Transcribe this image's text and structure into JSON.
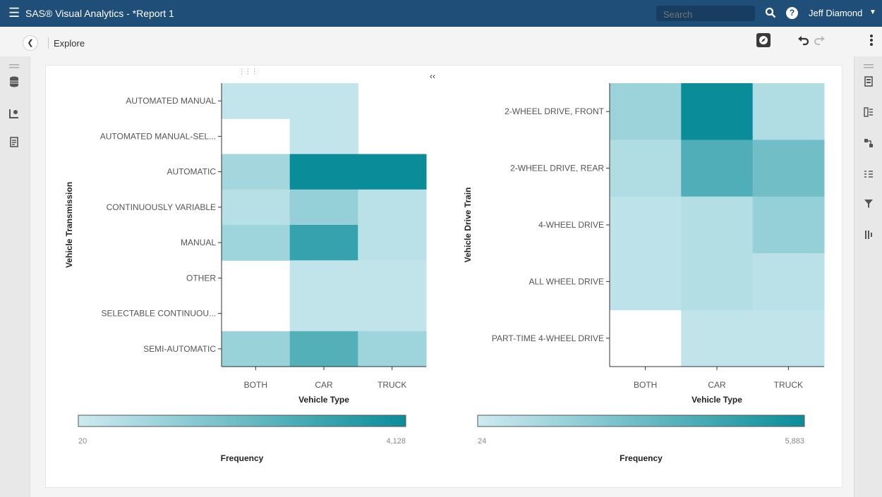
{
  "topbar": {
    "app_title": "SAS® Visual Analytics - *Report 1",
    "search_placeholder": "Search",
    "user_name": "Jeff Diamond"
  },
  "subbar": {
    "breadcrumb": "Explore"
  },
  "colors": {
    "header_bg": "#1f4f78",
    "heat_low": "#cdeaf0",
    "heat_high": "#0a8d99"
  },
  "chart_data": [
    {
      "type": "heatmap",
      "x": [
        "BOTH",
        "CAR",
        "TRUCK"
      ],
      "y": [
        "AUTOMATED MANUAL",
        "AUTOMATED MANUAL-SEL...",
        "AUTOMATIC",
        "CONTINUOUSLY VARIABLE",
        "MANUAL",
        "OTHER",
        "SELECTABLE CONTINUOU...",
        "SEMI-AUTOMATIC"
      ],
      "values": [
        [
          250,
          250,
          null
        ],
        [
          null,
          250,
          null
        ],
        [
          900,
          4128,
          4128
        ],
        [
          500,
          1200,
          400
        ],
        [
          1000,
          3200,
          400
        ],
        [
          null,
          300,
          300
        ],
        [
          null,
          300,
          300
        ],
        [
          1100,
          2600,
          1000
        ]
      ],
      "xlabel": "Vehicle Type",
      "ylabel": "Vehicle Transmission",
      "legend": {
        "title": "Frequency",
        "min": "20",
        "max": "4,128",
        "min_value": 20,
        "max_value": 4128
      }
    },
    {
      "type": "heatmap",
      "x": [
        "BOTH",
        "CAR",
        "TRUCK"
      ],
      "y": [
        "2-WHEEL DRIVE, FRONT",
        "2-WHEEL DRIVE, REAR",
        "4-WHEEL DRIVE",
        "ALL WHEEL DRIVE",
        "PART-TIME 4-WHEEL DRIVE"
      ],
      "values": [
        [
          1500,
          5883,
          900
        ],
        [
          900,
          3800,
          2800
        ],
        [
          500,
          800,
          1700
        ],
        [
          500,
          800,
          600
        ],
        [
          null,
          400,
          400
        ]
      ],
      "xlabel": "Vehicle Type",
      "ylabel": "Vehicle Drive Train",
      "legend": {
        "title": "Frequency",
        "min": "24",
        "max": "5,883",
        "min_value": 24,
        "max_value": 5883
      }
    }
  ]
}
